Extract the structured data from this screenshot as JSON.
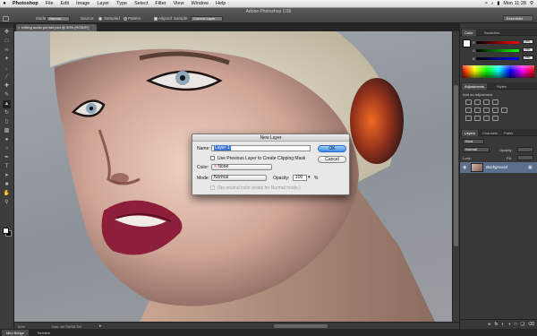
{
  "menubar": {
    "app_name": "Photoshop",
    "items": [
      "File",
      "Edit",
      "Image",
      "Layer",
      "Type",
      "Select",
      "Filter",
      "View",
      "Window",
      "Help"
    ],
    "clock": "Mon 11:28"
  },
  "options_bar": {
    "window_title": "Adobe Photoshop CS6",
    "mode_label": "Mode:",
    "mode_value": "Normal",
    "source_label": "Source:",
    "sampled_label": "Sampled",
    "pattern_label": "Pattern",
    "aligned_label": "Aligned",
    "sample_label": "Sample:",
    "sample_value": "Current Layer",
    "workspace_value": "Essentials"
  },
  "document": {
    "tab_title": "editing audio portrait.psd @ 50% (RGB/8*)",
    "zoom": "50%",
    "doc_size": "Doc: 45.7M/33.7M"
  },
  "bottom_tabs": [
    "Mini Bridge",
    "Timeline"
  ],
  "panels": {
    "color_tabs": [
      "Color",
      "Swatches"
    ],
    "color_sliders": [
      {
        "label": "R",
        "value": "255",
        "gradient": "linear-gradient(to right,#000,#f00)"
      },
      {
        "label": "G",
        "value": "255",
        "gradient": "linear-gradient(to right,#000,#0f0)"
      },
      {
        "label": "B",
        "value": "255",
        "gradient": "linear-gradient(to right,#000,#00f)"
      }
    ],
    "adjust_tabs": [
      "Adjustments",
      "Styles"
    ],
    "add_adjustment": "Add an adjustment",
    "layers_tabs": [
      "Layers",
      "Channels",
      "Paths"
    ],
    "kind_value": "Kind",
    "blend_value": "Normal",
    "opacity_label": "Opacity:",
    "lock_label": "Lock:",
    "fill_label": "Fill:",
    "layer_name": "Background"
  },
  "dialog": {
    "title": "New Layer",
    "name_label": "Name:",
    "name_value": "Layer 1",
    "clipping_label": "Use Previous Layer to Create Clipping Mask",
    "color_label": "Color:",
    "color_value": "None",
    "mode_label": "Mode:",
    "mode_value": "Normal",
    "opacity_label": "Opacity:",
    "opacity_value": "100",
    "percent": "%",
    "neutral_label": "(No neutral color exists for Normal mode.)",
    "ok_label": "OK",
    "cancel_label": "Cancel"
  }
}
